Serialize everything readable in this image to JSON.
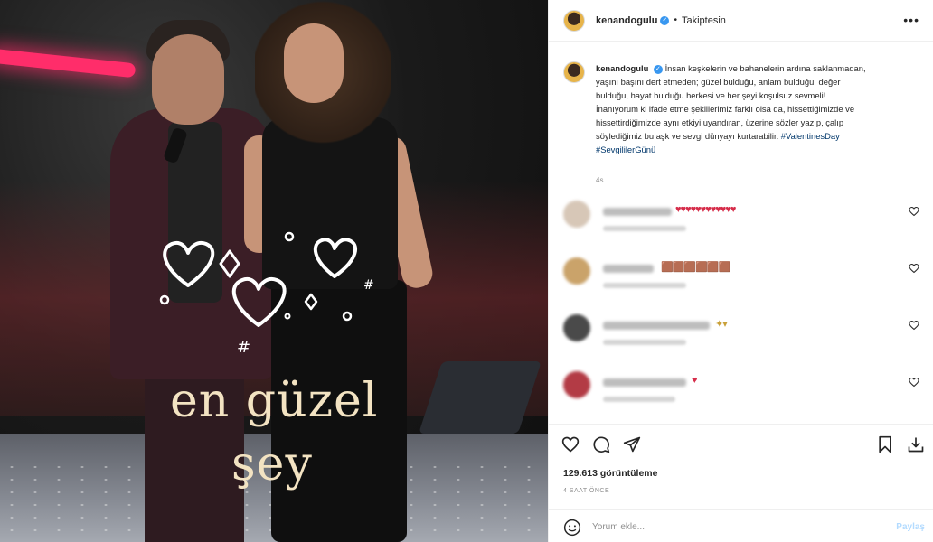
{
  "post": {
    "username": "kenandogulu",
    "follow_status": "Takiptesin",
    "more_label": "•••"
  },
  "photo": {
    "overlay_line1": "en güzel",
    "overlay_line2": "şey"
  },
  "caption": {
    "username": "kenandogulu",
    "text": "İnsan keşkelerin ve bahanelerin ardına saklanmadan, yaşını başını dert etmeden; güzel bulduğu, anlam bulduğu, değer bulduğu, hayat bulduğu herkesi ve her şeyi koşulsuz sevmeli! İnanıyorum ki ifade etme şekillerimiz farklı olsa da, hissettiğimizde ve hissettirdiğimizde aynı etkiyi uyandıran, üzerine sözler yazıp, çalıp söylediğimiz bu aşk ve sevgi dünyayı kurtarabilir.",
    "hashtags": "#ValentinesDay #SevgililerGünü",
    "time": "4s"
  },
  "comments": [
    {
      "emojis": "♥♥♥♥♥♥♥♥♥♥♥♥",
      "emoji_color": "#d62d4a"
    },
    {
      "emojis": "🟫🟫🟫🟫🟫🟫",
      "emoji_color": "#c89a5a"
    },
    {
      "emojis": "✦▾",
      "emoji_color": "#c9a13a"
    },
    {
      "emojis": "♥",
      "emoji_color": "#d62d4a"
    }
  ],
  "stats": {
    "views": "129.613 görüntüleme",
    "ago": "4 SAAT ÖNCE"
  },
  "composer": {
    "placeholder": "Yorum ekle...",
    "post_label": "Paylaş"
  },
  "colors": {
    "verified": "#3897f0",
    "hashtag": "#00376b",
    "muted": "#8e8e8e",
    "post_disabled": "#b3dbff"
  }
}
